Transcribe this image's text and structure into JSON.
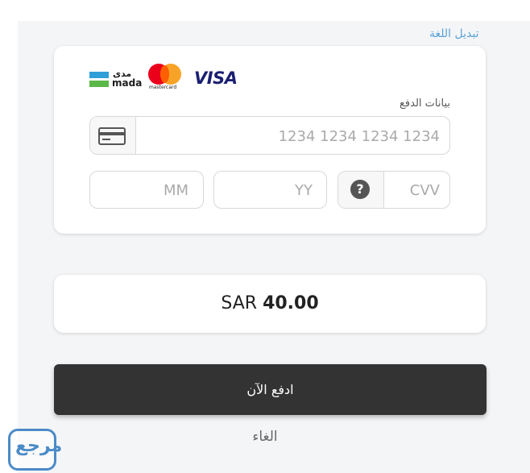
{
  "header": {
    "language_link": "تبديل اللغة"
  },
  "payment_card": {
    "brands": {
      "mada_ar": "مدى",
      "mada_en": "mada",
      "mastercard": "mastercard",
      "visa": "VISA"
    },
    "section_label": "بيانات الدفع",
    "card_number": {
      "placeholder": "1234 1234 1234 1234",
      "value": "",
      "icon": "credit-card-icon"
    },
    "expiry_month": {
      "placeholder": "MM",
      "value": ""
    },
    "expiry_year": {
      "placeholder": "YY",
      "value": ""
    },
    "cvv": {
      "placeholder": "CVV",
      "value": "",
      "help_icon": "?"
    }
  },
  "amount": {
    "currency": "SAR",
    "value": "40.00"
  },
  "actions": {
    "pay_label": "ادفع الآن",
    "cancel_label": "الغاء"
  },
  "colors": {
    "accent_link": "#5aa2d6",
    "pay_button": "#333333",
    "page_bg": "#f4f5f7"
  }
}
